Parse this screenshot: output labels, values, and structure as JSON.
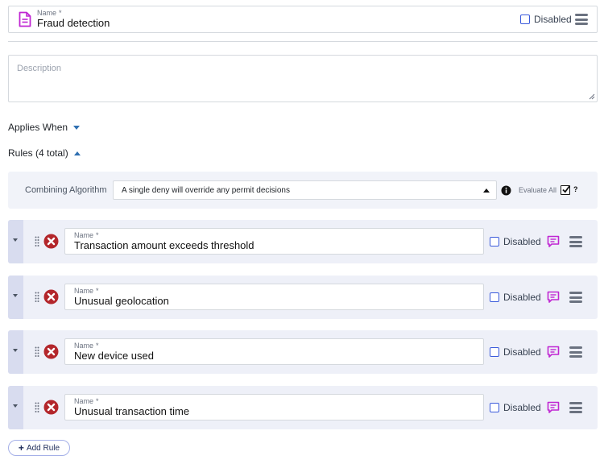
{
  "policy": {
    "name_label": "Name",
    "required_marker": "*",
    "name_value": "Fraud detection",
    "disabled_label": "Disabled",
    "icon": "document-icon"
  },
  "description": {
    "placeholder": "Description"
  },
  "applies_when": {
    "label": "Applies When"
  },
  "rules_section": {
    "label": "Rules (4 total)"
  },
  "combining": {
    "label": "Combining Algorithm",
    "selected": "A single deny will override any permit decisions",
    "evaluate_all_label": "Evaluate All",
    "evaluate_all_checked": true,
    "help": "?"
  },
  "rules": [
    {
      "name_label": "Name",
      "required_marker": "*",
      "name": "Transaction amount exceeds threshold",
      "disabled_label": "Disabled",
      "effect": "deny"
    },
    {
      "name_label": "Name",
      "required_marker": "*",
      "name": "Unusual geolocation",
      "disabled_label": "Disabled",
      "effect": "deny"
    },
    {
      "name_label": "Name",
      "required_marker": "*",
      "name": "New device used",
      "disabled_label": "Disabled",
      "effect": "deny"
    },
    {
      "name_label": "Name",
      "required_marker": "*",
      "name": "Unusual transaction time",
      "disabled_label": "Disabled",
      "effect": "deny"
    }
  ],
  "add_rule": {
    "label": "Add Rule"
  },
  "colors": {
    "accent": "#3b5bdb",
    "deny": "#b3262b",
    "comment": "#c026d3",
    "policy_icon": "#c026d3",
    "panel": "#eef0f8"
  }
}
